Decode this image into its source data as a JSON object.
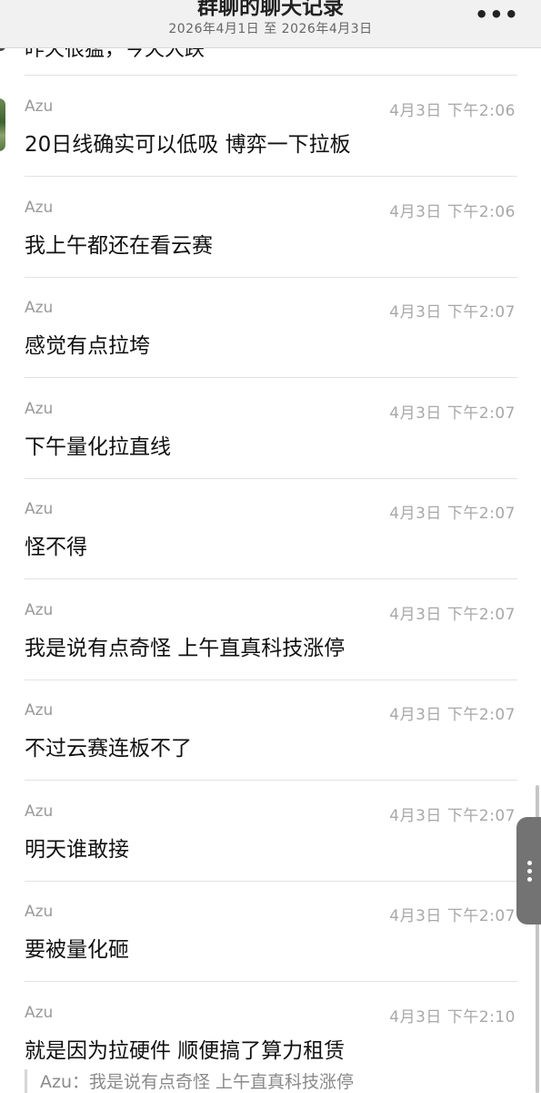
{
  "header": {
    "title": "群聊的聊天记录",
    "date_range": "2026年4月1日 至 2026年4月3日",
    "more_icon": "•••"
  },
  "previous_fragment": "昨天很猛，今天大跌",
  "messages": [
    {
      "sender": "Azu",
      "time": "4月3日 下午2:06",
      "text": "20日线确实可以低吸 博弈一下拉板"
    },
    {
      "sender": "Azu",
      "time": "4月3日 下午2:06",
      "text": "我上午都还在看云赛"
    },
    {
      "sender": "Azu",
      "time": "4月3日 下午2:07",
      "text": "感觉有点拉垮"
    },
    {
      "sender": "Azu",
      "time": "4月3日 下午2:07",
      "text": "下午量化拉直线"
    },
    {
      "sender": "Azu",
      "time": "4月3日 下午2:07",
      "text": "怪不得"
    },
    {
      "sender": "Azu",
      "time": "4月3日 下午2:07",
      "text": "我是说有点奇怪 上午直真科技涨停"
    },
    {
      "sender": "Azu",
      "time": "4月3日 下午2:07",
      "text": "不过云赛连板不了"
    },
    {
      "sender": "Azu",
      "time": "4月3日 下午2:07",
      "text": "明天谁敢接"
    },
    {
      "sender": "Azu",
      "time": "4月3日 下午2:07",
      "text": "要被量化砸"
    },
    {
      "sender": "Azu",
      "time": "4月3日 下午2:10",
      "text": "就是因为拉硬件 顺便搞了算力租赁",
      "quote": "Azu：我是说有点奇怪 上午直真科技涨停"
    }
  ]
}
